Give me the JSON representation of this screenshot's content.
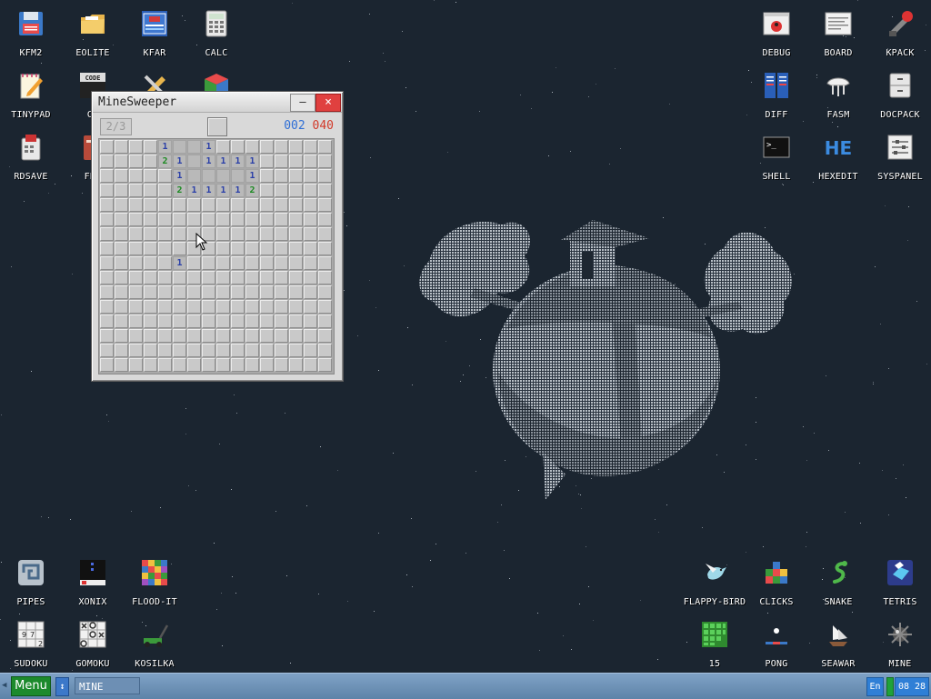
{
  "desktop": {
    "icons_left": [
      {
        "label": "KFM2",
        "icon": "floppy-icon"
      },
      {
        "label": "EOLITE",
        "icon": "folder-icon"
      },
      {
        "label": "KFAR",
        "icon": "kfar-icon"
      },
      {
        "label": "CALC",
        "icon": "calculator-icon"
      },
      {
        "label": "TINYPAD",
        "icon": "notepad-icon"
      },
      {
        "label": "CE",
        "icon": "code-icon"
      },
      {
        "label": "RDSAVE",
        "icon": "rdsave-icon"
      },
      {
        "label": "FB2",
        "icon": "book-icon"
      }
    ],
    "icons_right": [
      {
        "label": "DEBUG",
        "icon": "debug-icon"
      },
      {
        "label": "BOARD",
        "icon": "board-icon"
      },
      {
        "label": "KPACK",
        "icon": "kpack-icon"
      },
      {
        "label": "DIFF",
        "icon": "diff-icon"
      },
      {
        "label": "FASM",
        "icon": "fasm-icon"
      },
      {
        "label": "DOCPACK",
        "icon": "docpack-icon"
      },
      {
        "label": "SHELL",
        "icon": "shell-icon"
      },
      {
        "label": "HEXEDIT",
        "icon": "hexedit-icon"
      },
      {
        "label": "SYSPANEL",
        "icon": "syspanel-icon"
      }
    ],
    "games_left": [
      {
        "label": "PIPES",
        "icon": "pipes-icon"
      },
      {
        "label": "XONIX",
        "icon": "xonix-icon"
      },
      {
        "label": "FLOOD-IT",
        "icon": "flood-it-icon"
      },
      {
        "label": "SUDOKU",
        "icon": "sudoku-icon"
      },
      {
        "label": "GOMOKU",
        "icon": "gomoku-icon"
      },
      {
        "label": "KOSILKA",
        "icon": "lawnmower-icon"
      }
    ],
    "games_right": [
      {
        "label": "FLAPPY-BIRD",
        "icon": "bird-icon"
      },
      {
        "label": "CLICKS",
        "icon": "clicks-icon"
      },
      {
        "label": "SNAKE",
        "icon": "snake-icon"
      },
      {
        "label": "TETRIS",
        "icon": "tetris-icon"
      },
      {
        "label": "15",
        "icon": "fifteen-puzzle-icon"
      },
      {
        "label": "PONG",
        "icon": "pong-icon"
      },
      {
        "label": "SEAWAR",
        "icon": "ship-icon"
      },
      {
        "label": "MINE",
        "icon": "mine-icon"
      }
    ],
    "colors": {
      "background": "#1b2530",
      "label": "#ffffff"
    }
  },
  "minesweeper": {
    "title": "MineSweeper",
    "minimize": "–",
    "close": "×",
    "flags": "2/3",
    "counter_blue": "002",
    "counter_red": "040",
    "grid_size": 16,
    "open_cells": [
      {
        "r": 0,
        "c": 4,
        "n": "1"
      },
      {
        "r": 0,
        "c": 5,
        "n": ""
      },
      {
        "r": 0,
        "c": 6,
        "n": ""
      },
      {
        "r": 0,
        "c": 7,
        "n": "1"
      },
      {
        "r": 1,
        "c": 4,
        "n": "2"
      },
      {
        "r": 1,
        "c": 5,
        "n": "1"
      },
      {
        "r": 1,
        "c": 6,
        "n": ""
      },
      {
        "r": 1,
        "c": 7,
        "n": "1"
      },
      {
        "r": 1,
        "c": 8,
        "n": "1"
      },
      {
        "r": 1,
        "c": 9,
        "n": "1"
      },
      {
        "r": 1,
        "c": 10,
        "n": "1"
      },
      {
        "r": 2,
        "c": 5,
        "n": "1"
      },
      {
        "r": 2,
        "c": 6,
        "n": ""
      },
      {
        "r": 2,
        "c": 7,
        "n": ""
      },
      {
        "r": 2,
        "c": 8,
        "n": ""
      },
      {
        "r": 2,
        "c": 9,
        "n": ""
      },
      {
        "r": 2,
        "c": 10,
        "n": "1"
      },
      {
        "r": 3,
        "c": 5,
        "n": "2"
      },
      {
        "r": 3,
        "c": 6,
        "n": "1"
      },
      {
        "r": 3,
        "c": 7,
        "n": "1"
      },
      {
        "r": 3,
        "c": 8,
        "n": "1"
      },
      {
        "r": 3,
        "c": 9,
        "n": "1"
      },
      {
        "r": 3,
        "c": 10,
        "n": "2"
      },
      {
        "r": 8,
        "c": 5,
        "n": "1"
      }
    ]
  },
  "taskbar": {
    "menu_label": "Menu",
    "switch_label": "↕",
    "task_label": "MINE",
    "lang": "En",
    "clock": "08 28",
    "colors": {
      "bar": "#6e92b8",
      "menu": "#1c8a2c",
      "clock": "#2f7fd6"
    }
  }
}
